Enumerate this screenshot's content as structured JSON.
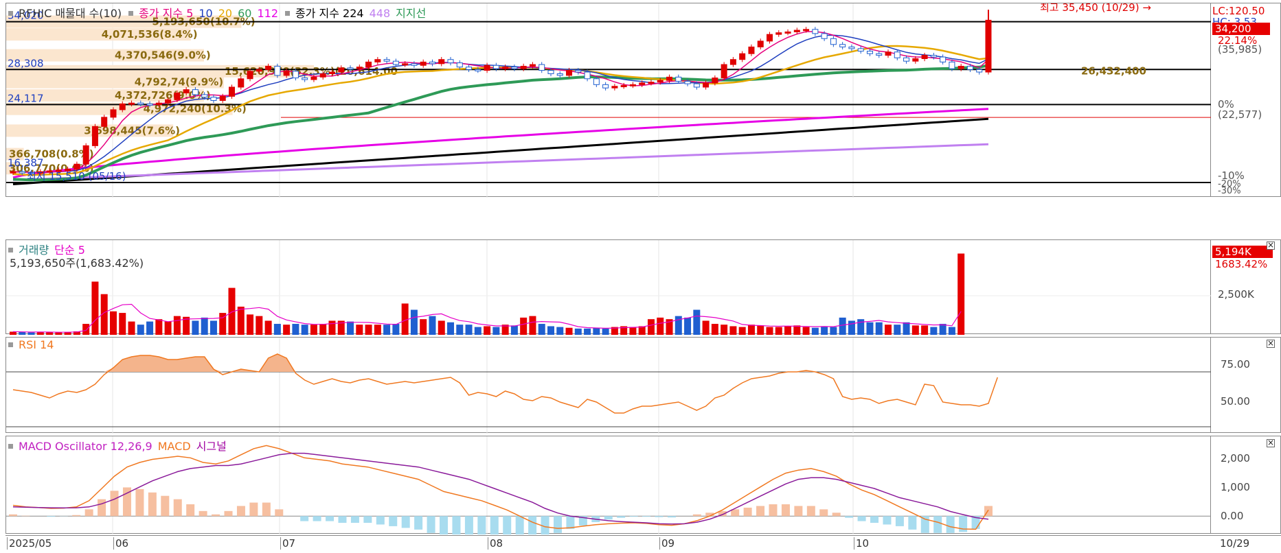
{
  "main_legend": [
    {
      "label": "RFHIC 매물대 수(10)",
      "color": "#333333"
    },
    {
      "label": "종가 지수 5",
      "color": "#e6007e"
    },
    {
      "label": "10",
      "color": "#1f3fbf"
    },
    {
      "label": "20",
      "color": "#e6a800"
    },
    {
      "label": "60",
      "color": "#2e9a57"
    },
    {
      "label": "112",
      "color": "#e600e6"
    },
    {
      "label": "종가 지수 224",
      "color": "#000000"
    },
    {
      "label": "448",
      "color": "#c080f0"
    },
    {
      "label": "지지선",
      "color": "#2e9a57"
    }
  ],
  "price_axis": {
    "lc": "LC:120.50",
    "hc": "HC: 3.53",
    "current": "34,200",
    "current_pct": "22.14%",
    "prev": "(35,985)",
    "zero_pct": "0%",
    "base": "(22,577)",
    "minus10": "-10%",
    "minus20": "-20%",
    "minus30": "-30%"
  },
  "left_levels": [
    "34,020",
    "28,308",
    "24,117",
    "16,387"
  ],
  "high_label": "최고 35,450 (10/29) →",
  "low_label": "최저 15,510 (05/16)",
  "volume_profile": [
    {
      "label": "5,193,650(10.7%)",
      "pct": 10.7
    },
    {
      "label": "4,071,536(8.4%)",
      "pct": 8.4
    },
    {
      "label": "4,370,546(9.0%)",
      "pct": 9.0
    },
    {
      "label": "15,620,970(32.3%)(20,614,00",
      "pct": 32.3
    },
    {
      "label": "4,792,74(9.9%)",
      "pct": 9.9
    },
    {
      "label": "4,372,726(9.0%)",
      "pct": 9.0
    },
    {
      "label": "4,972,240(10.3%)",
      "pct": 10.3
    },
    {
      "label": "3,698,445(7.6%)",
      "pct": 7.6
    },
    {
      "label": "366,708(0.8%)",
      "pct": 0.8
    },
    {
      "label": "306,770(0.6%)",
      "pct": 0.6
    }
  ],
  "overlap_label": "26,432,400",
  "volume_legend": {
    "name": "거래량",
    "ma": "단순 5",
    "info": "5,193,650주(1,683.42%)",
    "last": "5,194K",
    "last_pct": "1683.42%",
    "tick": "2,500K"
  },
  "rsi_legend": {
    "name": "RSI 14",
    "t75": "75.00",
    "t50": "50.00"
  },
  "macd_legend": {
    "osc": "MACD Oscillator 12,26,9",
    "macd": "MACD",
    "signal": "시그널",
    "t2000": "2,000",
    "t1000": "1,000",
    "t0": "0.00"
  },
  "x_labels": [
    "2025/05",
    "06",
    "07",
    "08",
    "09",
    "10"
  ],
  "x_last": "10/29",
  "chart_data": {
    "type": "candlestick",
    "period": "2025/05 – 10/29 (daily)",
    "ylim_price": [
      13000,
      36200
    ],
    "high": 35450,
    "low": 15510,
    "close_series": [
      16100,
      16000,
      15900,
      16100,
      16200,
      16300,
      16400,
      17000,
      19200,
      21500,
      22600,
      23500,
      24200,
      24300,
      24200,
      24100,
      24300,
      24700,
      25500,
      25900,
      25300,
      25000,
      24600,
      25100,
      26200,
      27200,
      28100,
      28300,
      28700,
      27600,
      28100,
      27300,
      27100,
      27400,
      27800,
      28000,
      28500,
      28400,
      28600,
      29200,
      29500,
      29300,
      28900,
      29000,
      28800,
      29200,
      29000,
      29500,
      29100,
      28600,
      28300,
      28200,
      28800,
      28400,
      28600,
      28400,
      28700,
      28900,
      28200,
      27800,
      27600,
      28200,
      28000,
      27200,
      26500,
      26100,
      26300,
      26400,
      26500,
      26700,
      26800,
      27000,
      27400,
      26900,
      26600,
      26200,
      26700,
      27300,
      28900,
      29500,
      30200,
      31000,
      31700,
      32500,
      32700,
      32800,
      33000,
      33100,
      32600,
      32000,
      31300,
      31000,
      30800,
      30500,
      30200,
      30000,
      30400,
      29700,
      29300,
      29600,
      30000,
      29800,
      29200,
      28400,
      28700,
      28300,
      28000,
      34200
    ],
    "volume_series": [
      200,
      180,
      150,
      190,
      160,
      150,
      180,
      220,
      700,
      3400,
      2600,
      1500,
      1400,
      850,
      650,
      850,
      1000,
      850,
      1200,
      1150,
      900,
      1100,
      900,
      1400,
      3000,
      1800,
      1300,
      1200,
      900,
      700,
      650,
      700,
      650,
      650,
      700,
      900,
      900,
      850,
      650,
      650,
      650,
      650,
      700,
      2000,
      1600,
      1000,
      1200,
      900,
      800,
      650,
      650,
      500,
      550,
      500,
      650,
      600,
      1100,
      1200,
      700,
      550,
      500,
      450,
      400,
      400,
      450,
      400,
      500,
      550,
      500,
      550,
      1000,
      1100,
      1000,
      1200,
      1100,
      1600,
      900,
      700,
      650,
      550,
      500,
      650,
      600,
      500,
      500,
      550,
      600,
      500,
      450,
      550,
      500,
      1100,
      900,
      1000,
      800,
      800,
      650,
      650,
      800,
      600,
      600,
      500,
      700,
      500,
      5194
    ],
    "rsi_series": [
      57,
      56,
      55,
      53,
      51,
      54,
      56,
      55,
      57,
      61,
      68,
      73,
      79,
      81,
      82,
      82,
      81,
      79,
      79,
      80,
      81,
      81,
      72,
      68,
      70,
      72,
      71,
      70,
      80,
      83,
      80,
      69,
      64,
      61,
      63,
      65,
      63,
      62,
      64,
      65,
      63,
      61,
      62,
      63,
      62,
      63,
      64,
      65,
      66,
      62,
      53,
      55,
      54,
      52,
      56,
      54,
      50,
      49,
      52,
      51,
      48,
      46,
      44,
      50,
      48,
      44,
      40,
      40,
      43,
      45,
      45,
      46,
      47,
      48,
      45,
      42,
      45,
      51,
      53,
      58,
      62,
      65,
      66,
      67,
      69,
      70,
      70,
      71,
      70,
      68,
      65,
      52,
      50,
      51,
      50,
      47,
      49,
      50,
      48,
      46,
      61,
      60,
      48,
      47,
      46,
      46,
      45,
      47,
      66
    ],
    "macd_series": [
      350,
      300,
      280,
      250,
      260,
      300,
      500,
      900,
      1300,
      1600,
      1750,
      1850,
      1900,
      1950,
      1900,
      1750,
      1700,
      1800,
      2000,
      2200,
      2300,
      2200,
      2050,
      1900,
      1850,
      1800,
      1700,
      1650,
      1600,
      1500,
      1400,
      1300,
      1200,
      1000,
      800,
      700,
      600,
      500,
      350,
      200,
      0,
      -200,
      -350,
      -400,
      -380,
      -330,
      -280,
      -250,
      -230,
      -220,
      -240,
      -280,
      -300,
      -250,
      -150,
      0,
      200,
      450,
      700,
      950,
      1200,
      1400,
      1500,
      1550,
      1450,
      1300,
      1050,
      850,
      700,
      500,
      300,
      100,
      -100,
      -200,
      -350,
      -420,
      -430,
      200
    ],
    "signal_series": [
      300,
      290,
      280,
      270,
      265,
      270,
      300,
      400,
      550,
      750,
      950,
      1150,
      1300,
      1450,
      1550,
      1600,
      1650,
      1650,
      1700,
      1800,
      1900,
      2000,
      2050,
      2050,
      2000,
      1950,
      1900,
      1850,
      1800,
      1750,
      1700,
      1650,
      1600,
      1500,
      1400,
      1300,
      1200,
      1050,
      900,
      750,
      600,
      450,
      250,
      100,
      0,
      -50,
      -100,
      -150,
      -180,
      -200,
      -220,
      -250,
      -260,
      -250,
      -200,
      -100,
      50,
      250,
      450,
      650,
      850,
      1050,
      1200,
      1250,
      1250,
      1200,
      1100,
      1000,
      900,
      750,
      600,
      500,
      400,
      300,
      150,
      50,
      -50,
      -100
    ],
    "ylim_rsi": [
      25,
      95
    ],
    "ylim_macd": [
      -600,
      2600
    ],
    "ylim_volume": [
      0,
      5700000
    ]
  }
}
